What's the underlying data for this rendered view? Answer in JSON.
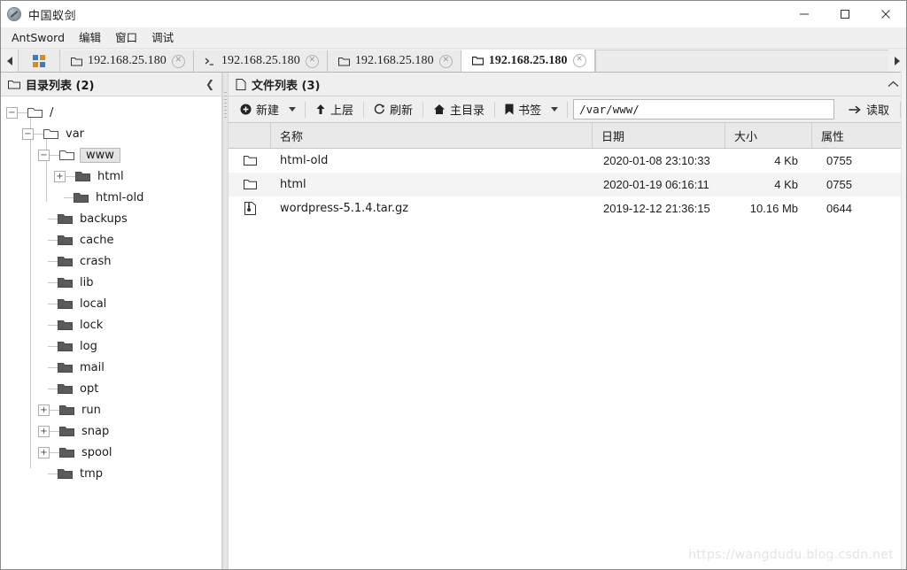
{
  "window": {
    "title": "中国蚁剑",
    "app_icon": "antsword-logo-icon",
    "controls": {
      "minimize": "—",
      "maximize": "□",
      "close": "✕"
    }
  },
  "menubar": {
    "items": [
      {
        "label": "AntSword"
      },
      {
        "label": "编辑"
      },
      {
        "label": "窗口"
      },
      {
        "label": "调试"
      }
    ]
  },
  "tabbar": {
    "scroll_left": "◀",
    "scroll_right": "▶",
    "grid_button": "grid-apps-icon",
    "close_glyph": "✕",
    "tabs": [
      {
        "label": "192.168.25.180",
        "icon": "folder-icon",
        "active": false
      },
      {
        "label": "192.168.25.180",
        "icon": "terminal-icon",
        "active": false
      },
      {
        "label": "192.168.25.180",
        "icon": "folder-icon",
        "active": false
      },
      {
        "label": "192.168.25.180",
        "icon": "folder-icon",
        "active": true
      }
    ]
  },
  "left_panel": {
    "header": {
      "icon": "folder-icon",
      "title": "目录列表 (2)",
      "collapse": "❮"
    },
    "tree": [
      {
        "label": "/",
        "depth": 0,
        "expander": "minus",
        "folder": "open",
        "selected": false
      },
      {
        "label": "var",
        "depth": 1,
        "expander": "minus",
        "folder": "open",
        "selected": false
      },
      {
        "label": "www",
        "depth": 2,
        "expander": "minus",
        "folder": "open",
        "selected": true
      },
      {
        "label": "html",
        "depth": 3,
        "expander": "plus",
        "folder": "solid",
        "selected": false
      },
      {
        "label": "html-old",
        "depth": 3,
        "expander": "none",
        "folder": "solid",
        "selected": false
      },
      {
        "label": "backups",
        "depth": 2,
        "expander": "none",
        "folder": "solid",
        "selected": false
      },
      {
        "label": "cache",
        "depth": 2,
        "expander": "none",
        "folder": "solid",
        "selected": false
      },
      {
        "label": "crash",
        "depth": 2,
        "expander": "none",
        "folder": "solid",
        "selected": false
      },
      {
        "label": "lib",
        "depth": 2,
        "expander": "none",
        "folder": "solid",
        "selected": false
      },
      {
        "label": "local",
        "depth": 2,
        "expander": "none",
        "folder": "solid",
        "selected": false
      },
      {
        "label": "lock",
        "depth": 2,
        "expander": "none",
        "folder": "solid",
        "selected": false
      },
      {
        "label": "log",
        "depth": 2,
        "expander": "none",
        "folder": "solid",
        "selected": false
      },
      {
        "label": "mail",
        "depth": 2,
        "expander": "none",
        "folder": "solid",
        "selected": false
      },
      {
        "label": "opt",
        "depth": 2,
        "expander": "none",
        "folder": "solid",
        "selected": false
      },
      {
        "label": "run",
        "depth": 2,
        "expander": "plus",
        "folder": "solid",
        "selected": false
      },
      {
        "label": "snap",
        "depth": 2,
        "expander": "plus",
        "folder": "solid",
        "selected": false
      },
      {
        "label": "spool",
        "depth": 2,
        "expander": "plus",
        "folder": "solid",
        "selected": false
      },
      {
        "label": "tmp",
        "depth": 2,
        "expander": "none",
        "folder": "solid",
        "selected": false
      }
    ]
  },
  "right_panel": {
    "header": {
      "icon": "file-icon",
      "title": "文件列表 (3)",
      "collapse": "❮"
    },
    "toolbar": {
      "new_label": "新建",
      "new_icon": "plus-circle-icon",
      "up_label": "上层",
      "up_icon": "arrow-up-icon",
      "refresh_label": "刷新",
      "refresh_icon": "refresh-icon",
      "home_label": "主目录",
      "home_icon": "home-icon",
      "bookmark_label": "书签",
      "bookmark_icon": "bookmark-icon",
      "path_value": "/var/www/",
      "path_placeholder": "/var/www/",
      "read_label": "读取",
      "read_icon": "arrow-right-icon"
    },
    "table": {
      "columns": [
        "",
        "名称",
        "日期",
        "大小",
        "属性"
      ],
      "rows": [
        {
          "icon": "folder-icon",
          "name": "html-old",
          "date": "2020-01-08 23:10:33",
          "size": "4 Kb",
          "attr": "0755"
        },
        {
          "icon": "folder-icon",
          "name": "html",
          "date": "2020-01-19 06:16:11",
          "size": "4 Kb",
          "attr": "0755"
        },
        {
          "icon": "archive-icon",
          "name": "wordpress-5.1.4.tar.gz",
          "date": "2019-12-12 21:36:15",
          "size": "10.16 Mb",
          "attr": "0644"
        }
      ]
    }
  },
  "watermark": {
    "text": "https://wangdudu.blog.csdn.net"
  },
  "colors": {
    "accent_blue": "#3b7dbd",
    "accent_orange": "#d98b2b",
    "window_bg": "#f0f0f0",
    "panel_bg": "#efefef",
    "row_alt": "#f4f4f4",
    "selection": "#e4e4e4",
    "watermark": "#e2e4e6"
  }
}
